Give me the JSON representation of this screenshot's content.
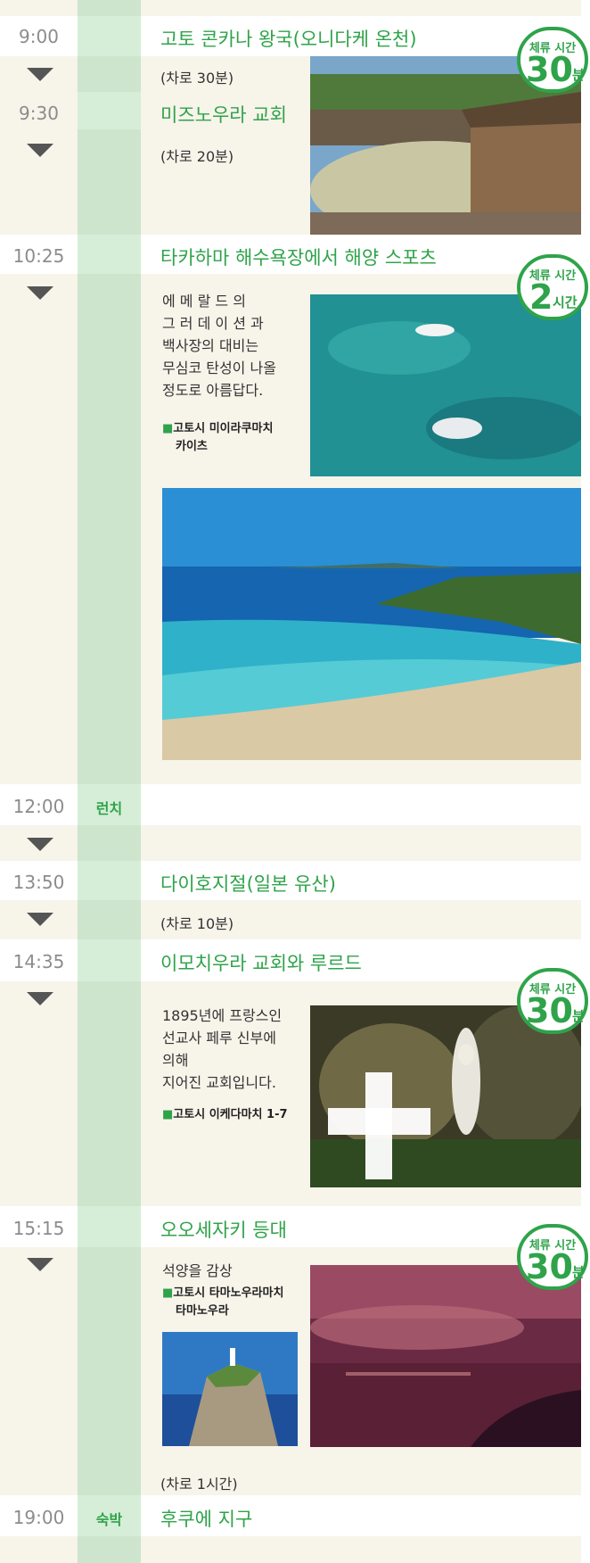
{
  "stay_badge": {
    "label": "체류 시간"
  },
  "schedule": [
    {
      "time": "9:00",
      "title": "고토 콘카나 왕국(오니다케 온천)",
      "transit": "(차로 30분)",
      "stay": {
        "value": "30",
        "unit": "분"
      }
    },
    {
      "time": "9:30",
      "title": "미즈노우라 교회",
      "transit": "(차로 20분)"
    },
    {
      "time": "10:25",
      "title": "타카하마 해수욕장에서 해양 스포츠",
      "description": [
        "에 메 랄 드 의",
        "그 러 데 이 션 과",
        "백사장의 대비는",
        "무심코 탄성이 나올",
        "정도로 아름답다."
      ],
      "address": [
        "고토시 미이라쿠마치",
        "카이츠"
      ],
      "stay": {
        "value": "2",
        "unit": "시간"
      }
    },
    {
      "time": "12:00",
      "tag": "런치"
    },
    {
      "time": "13:50",
      "title": "다이호지절(일본 유산)",
      "transit": "(차로 10분)"
    },
    {
      "time": "14:35",
      "title": "이모치우라 교회와 루르드",
      "description": [
        "1895년에 프랑스인",
        "선교사 페루 신부에",
        "의해",
        "지어진 교회입니다."
      ],
      "address": [
        "고토시 이케다마치 1-7"
      ],
      "stay": {
        "value": "30",
        "unit": "분"
      }
    },
    {
      "time": "15:15",
      "title": "오오세자키 등대",
      "description": [
        "석양을 감상"
      ],
      "address": [
        "고토시 타마노우라마치",
        "타마노우라"
      ],
      "transit": "(차로 1시간)",
      "stay": {
        "value": "30",
        "unit": "분"
      }
    },
    {
      "time": "19:00",
      "tag": "숙박",
      "title": "후쿠에 지구"
    }
  ]
}
